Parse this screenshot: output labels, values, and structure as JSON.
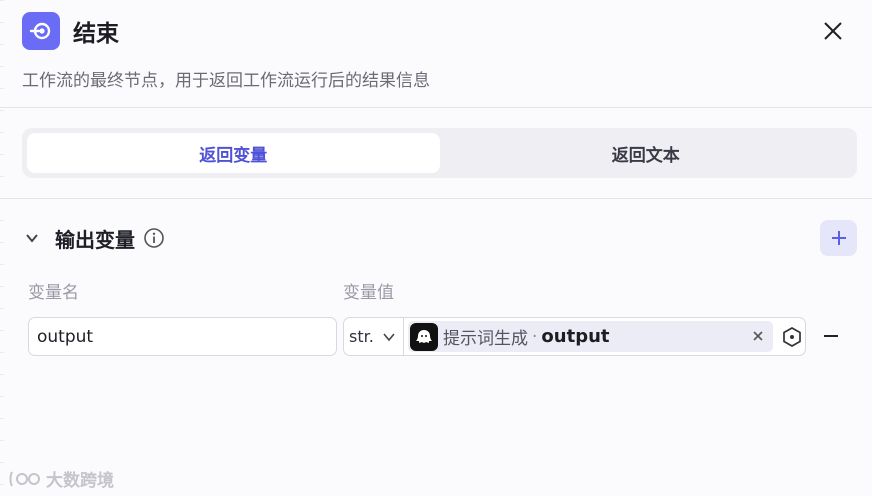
{
  "header": {
    "title": "结束",
    "icon": "exit-node-icon",
    "close_icon": "close-icon",
    "accent": "#6a6cf6"
  },
  "subtitle": "工作流的最终节点，用于返回工作流运行后的结果信息",
  "tabs": [
    {
      "label": "返回变量",
      "active": true
    },
    {
      "label": "返回文本",
      "active": false
    }
  ],
  "output_section": {
    "title": "输出变量",
    "info_icon": "info-icon",
    "add_icon": "plus-icon",
    "columns": {
      "name": "变量名",
      "value": "变量值"
    },
    "rows": [
      {
        "name": "output",
        "type": "str.",
        "ref_node": "提示词生成",
        "ref_sep": "·",
        "ref_var": "output"
      }
    ]
  },
  "watermark": {
    "text": "大数跨境"
  },
  "colors": {
    "accent_text": "#4f52d6",
    "add_bg": "#e6e6fb"
  }
}
